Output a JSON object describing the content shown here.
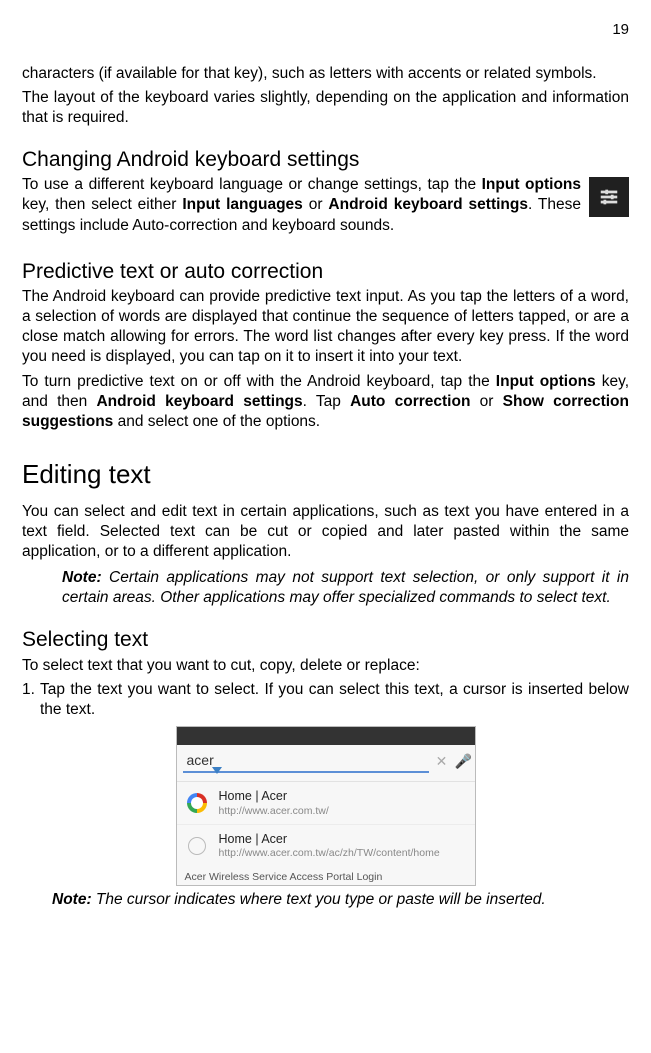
{
  "page_number": "19",
  "intro_para_1": "characters (if available for that key), such as letters with accents or related symbols.",
  "intro_para_2": "The layout of the keyboard varies slightly, depending on the application and information that is required.",
  "changing_heading": "Changing Android keyboard settings",
  "changing_para_pre": "To use a different keyboard language or change settings, tap the ",
  "changing_b1": "Input options",
  "changing_mid1": " key, then select either ",
  "changing_b2": "Input languages",
  "changing_mid2": " or ",
  "changing_b3": "Android keyboard settings",
  "changing_post": ". These settings include Auto-correction and keyboard sounds.",
  "predictive_heading": "Predictive text or auto correction",
  "predictive_para_1": "The Android keyboard can provide predictive text input. As you tap the letters of a word, a selection of words are displayed that continue the sequence of letters tapped, or are a close match allowing for errors. The word list changes after every key press. If the word you need is displayed, you can tap on it to insert it into your text.",
  "predictive_p2_pre": "To turn predictive text on or off with the Android keyboard, tap the ",
  "predictive_b1": "Input options",
  "predictive_p2_mid1": " key, and then ",
  "predictive_b2": "Android keyboard settings",
  "predictive_p2_mid2": ". Tap ",
  "predictive_b3": "Auto correction",
  "predictive_p2_mid3": " or ",
  "predictive_b4": "Show correction suggestions",
  "predictive_p2_post": " and select one of the options.",
  "editing_heading": "Editing text",
  "editing_para": "You can select and edit text in certain applications, such as text you have entered in a text field. Selected text can be cut or copied and later pasted within the same application, or to a different application.",
  "note_label": "Note:",
  "editing_note_body": " Certain applications may not support text selection, or only support it in certain areas. Other applications may offer specialized commands to select text.",
  "selecting_heading": "Selecting text",
  "selecting_intro": "To select text that you want to cut, copy, delete or replace:",
  "step1_num": "1.",
  "step1_body": "Tap the text you want to select. If you can select this text, a cursor is inserted below the text.",
  "screenshot": {
    "search_value": "acer",
    "row1_title": "Home | Acer",
    "row1_url": "http://www.acer.com.tw/",
    "row2_title": "Home | Acer",
    "row2_url": "http://www.acer.com.tw/ac/zh/TW/content/home",
    "row3_title": "Acer Wireless Service Access Portal Login"
  },
  "final_note_body": " The cursor indicates where text you type or paste will be inserted."
}
